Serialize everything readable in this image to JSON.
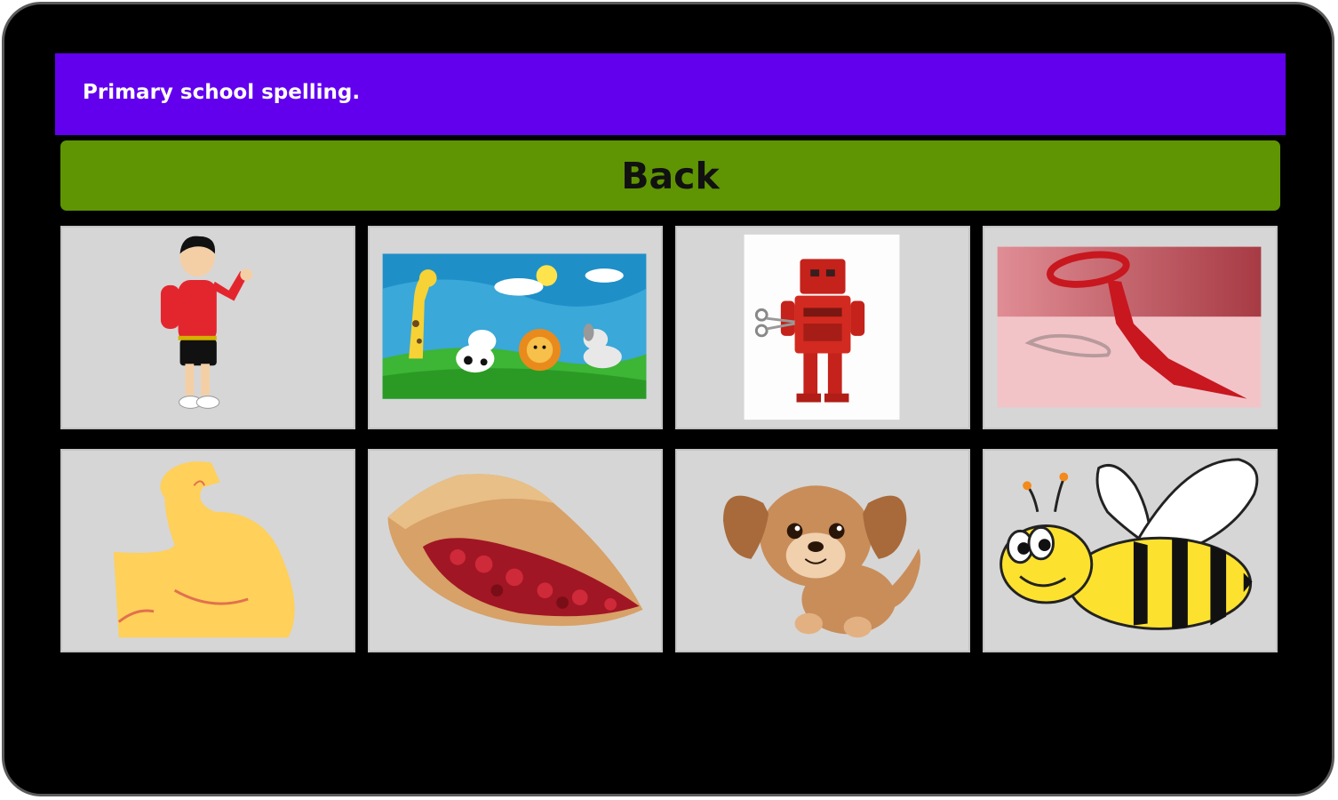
{
  "app": {
    "title": "Primary school spelling."
  },
  "toolbar": {
    "back_label": "Back"
  },
  "colors": {
    "appbar": "#6200ee",
    "back_button": "#5f9503",
    "tile": "#d6d6d6",
    "background": "#000000"
  },
  "tiles": [
    {
      "icon": "boy-icon"
    },
    {
      "icon": "farm-animals-icon"
    },
    {
      "icon": "robot-icon"
    },
    {
      "icon": "tie-icon"
    },
    {
      "icon": "arm-muscle-icon"
    },
    {
      "icon": "pie-icon"
    },
    {
      "icon": "puppy-icon"
    },
    {
      "icon": "bee-icon"
    }
  ]
}
